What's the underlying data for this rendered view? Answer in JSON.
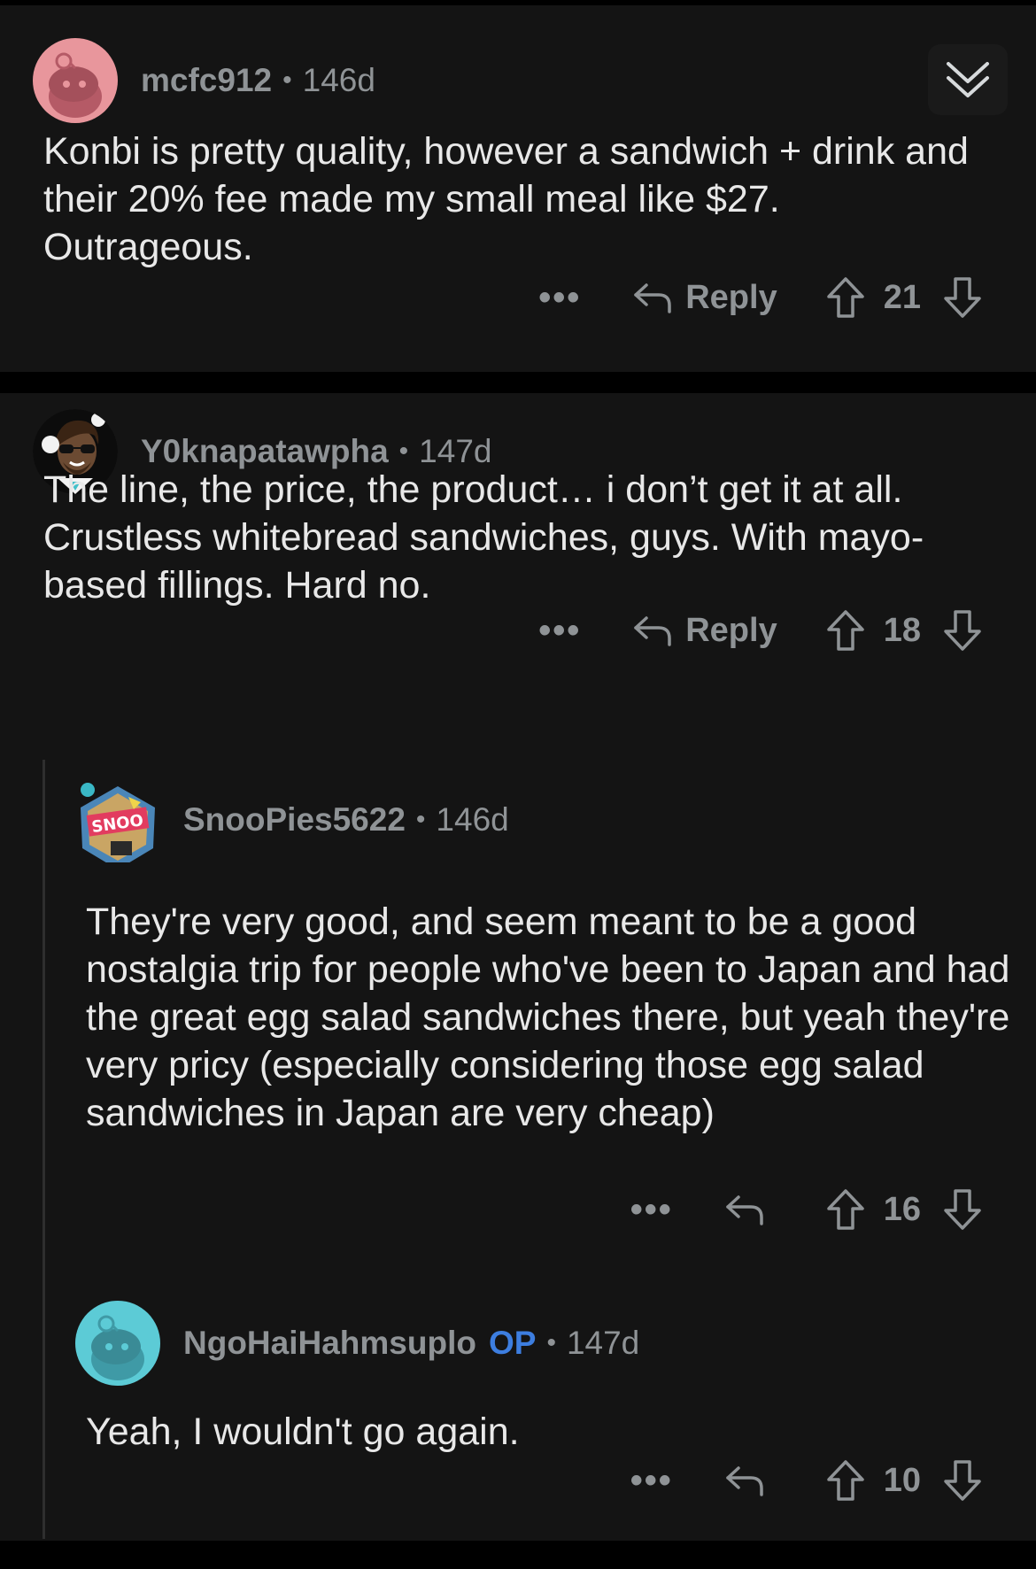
{
  "comments": [
    {
      "username": "mcfc912",
      "age": "146d",
      "text": "Konbi is pretty quality, however a sandwich + drink and their 20% fee made my small meal like $27. Outrageous.",
      "reply_label": "Reply",
      "score": "21",
      "avatar_color": "#e8969c"
    },
    {
      "username": "Y0knapatawpha",
      "age": "147d",
      "text": "The line, the price, the product… i don’t get it at all. Crustless whitebread sandwiches, guys. With mayo-based fillings. Hard no.",
      "reply_label": "Reply",
      "score": "18"
    },
    {
      "username": "SnooPies5622",
      "age": "146d",
      "text": "They're very good, and seem meant to be a good nostalgia trip for people who've been to Japan and had the great egg salad sandwiches there, but yeah they're very pricy (especially considering those egg salad sandwiches in Japan are very cheap)",
      "score": "16"
    },
    {
      "username": "NgoHaiHahmsuplo",
      "op_badge": "OP",
      "age": "147d",
      "text": "Yeah, I wouldn't go again.",
      "score": "10",
      "avatar_color": "#5ccbd6"
    }
  ],
  "separator": "•",
  "more_glyph": "•••",
  "colors": {
    "background": "#000000",
    "card": "#141414",
    "text": "#e8e8e8",
    "meta": "#8f9396",
    "op": "#3d7ee0"
  }
}
